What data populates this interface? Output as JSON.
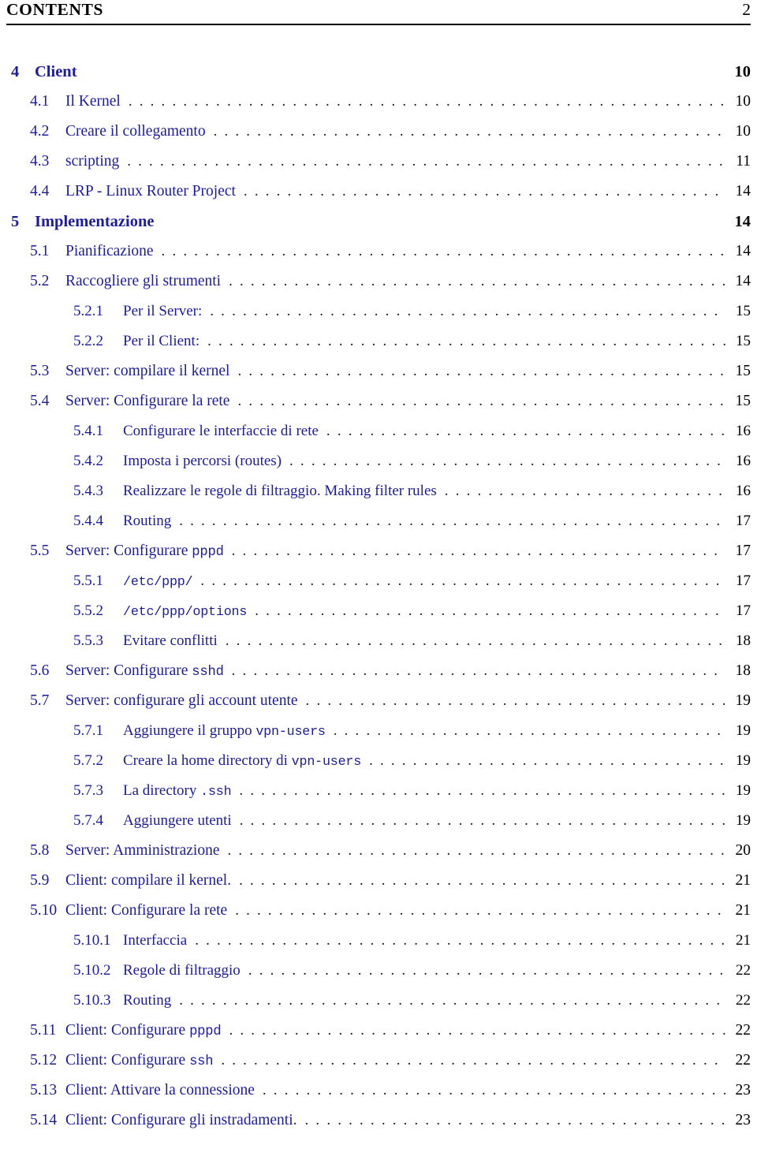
{
  "header": {
    "title": "CONTENTS",
    "page_number": "2"
  },
  "colors": {
    "link_blue": "#1c1c9c",
    "text_black": "#000000",
    "leader_dots": "#1a1a1a",
    "page_background": "#ffffff"
  },
  "toc": {
    "entries": [
      {
        "level": "chapter",
        "number": "4",
        "title": "Client",
        "page": "10"
      },
      {
        "level": "section",
        "number": "4.1",
        "title": "Il Kernel",
        "page": "10"
      },
      {
        "level": "section",
        "number": "4.2",
        "title": "Creare il collegamento",
        "page": "10"
      },
      {
        "level": "section",
        "number": "4.3",
        "title": "scripting",
        "page": "11"
      },
      {
        "level": "section",
        "number": "4.4",
        "title": "LRP - Linux Router Project",
        "page": "14"
      },
      {
        "level": "chapter",
        "number": "5",
        "title": "Implementazione",
        "page": "14"
      },
      {
        "level": "section",
        "number": "5.1",
        "title": "Pianificazione",
        "page": "14"
      },
      {
        "level": "section",
        "number": "5.2",
        "title": "Raccogliere gli strumenti",
        "page": "14"
      },
      {
        "level": "subsection",
        "number": "5.2.1",
        "title": "Per il Server:",
        "page": "15"
      },
      {
        "level": "subsection",
        "number": "5.2.2",
        "title": "Per il Client:",
        "page": "15"
      },
      {
        "level": "section",
        "number": "5.3",
        "title": "Server: compilare il kernel",
        "page": "15"
      },
      {
        "level": "section",
        "number": "5.4",
        "title": "Server: Configurare la rete",
        "page": "15"
      },
      {
        "level": "subsection",
        "number": "5.4.1",
        "title": "Configurare le interfaccie di rete",
        "page": "16"
      },
      {
        "level": "subsection",
        "number": "5.4.2",
        "title": "Imposta i percorsi (routes)",
        "page": "16"
      },
      {
        "level": "subsection",
        "number": "5.4.3",
        "title": "Realizzare le regole di filtraggio. Making filter rules",
        "page": "16"
      },
      {
        "level": "subsection",
        "number": "5.4.4",
        "title": "Routing",
        "page": "17"
      },
      {
        "level": "section",
        "number": "5.5",
        "title": "Server: Configurare ",
        "title_mono": "pppd",
        "page": "17"
      },
      {
        "level": "subsection",
        "number": "5.5.1",
        "title": "",
        "title_mono": "/etc/ppp/",
        "page": "17"
      },
      {
        "level": "subsection",
        "number": "5.5.2",
        "title": "",
        "title_mono": "/etc/ppp/options",
        "page": "17"
      },
      {
        "level": "subsection",
        "number": "5.5.3",
        "title": "Evitare conflitti",
        "page": "18"
      },
      {
        "level": "section",
        "number": "5.6",
        "title": "Server: Configurare ",
        "title_mono": "sshd",
        "page": "18"
      },
      {
        "level": "section",
        "number": "5.7",
        "title": "Server: configurare gli account utente",
        "page": "19"
      },
      {
        "level": "subsection",
        "number": "5.7.1",
        "title": "Aggiungere il gruppo ",
        "title_mono": "vpn-users",
        "page": "19"
      },
      {
        "level": "subsection",
        "number": "5.7.2",
        "title": "Creare la home directory di ",
        "title_mono": "vpn-users",
        "page": "19"
      },
      {
        "level": "subsection",
        "number": "5.7.3",
        "title": "La directory ",
        "title_mono": ".ssh",
        "page": "19"
      },
      {
        "level": "subsection",
        "number": "5.7.4",
        "title": "Aggiungere utenti",
        "page": "19"
      },
      {
        "level": "section",
        "number": "5.8",
        "title": "Server: Amministrazione",
        "page": "20"
      },
      {
        "level": "section",
        "number": "5.9",
        "title": "Client: compilare il kernel.",
        "page": "21"
      },
      {
        "level": "section",
        "number": "5.10",
        "title": "Client: Configurare la rete",
        "page": "21"
      },
      {
        "level": "subsection",
        "number": "5.10.1",
        "title": "Interfaccia",
        "page": "21"
      },
      {
        "level": "subsection",
        "number": "5.10.2",
        "title": "Regole di filtraggio",
        "page": "22"
      },
      {
        "level": "subsection",
        "number": "5.10.3",
        "title": "Routing",
        "page": "22"
      },
      {
        "level": "section",
        "number": "5.11",
        "title": "Client: Configurare ",
        "title_mono": "pppd",
        "page": "22"
      },
      {
        "level": "section",
        "number": "5.12",
        "title": "Client: Configurare ",
        "title_mono": "ssh",
        "page": "22"
      },
      {
        "level": "section",
        "number": "5.13",
        "title": "Client: Attivare la connessione",
        "page": "23"
      },
      {
        "level": "section",
        "number": "5.14",
        "title": "Client: Configurare gli instradamenti.",
        "page": "23"
      }
    ]
  }
}
